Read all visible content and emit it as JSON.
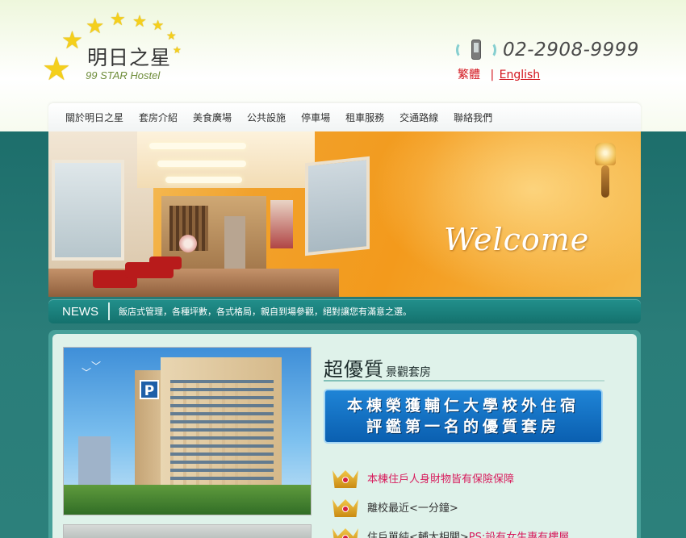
{
  "logo": {
    "name": "明日之星",
    "subtitle": "99 STAR Hostel"
  },
  "contact": {
    "phone": "02-2908-9999",
    "lang_traditional": "繁體",
    "lang_separator": "|",
    "lang_english": "English"
  },
  "nav": {
    "items": [
      "關於明日之星",
      "套房介紹",
      "美食廣場",
      "公共設施",
      "停車場",
      "租車服務",
      "交通路線",
      "聯絡我們"
    ]
  },
  "banner": {
    "welcome": "Welcome"
  },
  "news": {
    "label": "NEWS",
    "text": "飯店式管理，各種坪數，各式格局，親自到場參觀，絕對讓您有滿意之選。"
  },
  "suite": {
    "title_big": "超優質",
    "title_small": "景觀套房",
    "award_line1": "本棟榮獲輔仁大學校外住宿",
    "award_line2": "評鑑第一名的優質套房"
  },
  "features": [
    {
      "text": "本棟住戶人身財物皆有保險保障",
      "note": ""
    },
    {
      "text": "離校最近<一分鐘>",
      "note": ""
    },
    {
      "text": "住戶單純<輔大相關>",
      "note": "PS:設有女生專有樓層"
    }
  ],
  "colors": {
    "brand_teal": "#1f6f6c",
    "accent_red": "#d3141d",
    "highlight_pink": "#d81b5c",
    "award_blue": "#0a5fb0"
  }
}
